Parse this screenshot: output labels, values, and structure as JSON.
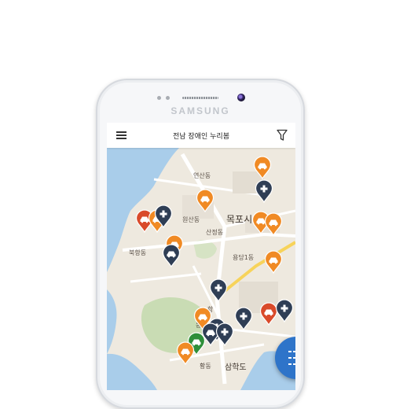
{
  "device": {
    "brand": "SAMSUNG"
  },
  "appbar": {
    "title": "전남 장애인 누리봄"
  },
  "map": {
    "labels": {
      "yeonsan": "연산동",
      "mokpo": "목포시",
      "wonsan": "원산동",
      "sanjeong": "산정동",
      "bukhang": "북항동",
      "yongdang": "용당1동",
      "dong": "동",
      "hwangdong": "황동",
      "samhakdo": "삼학도",
      "hang": "항"
    }
  },
  "colors": {
    "fab": "#2e74c9",
    "pin_orange": "#f08a24",
    "pin_navy": "#2f3e55",
    "pin_green": "#2f8f3a",
    "pin_red": "#d94a2a"
  }
}
